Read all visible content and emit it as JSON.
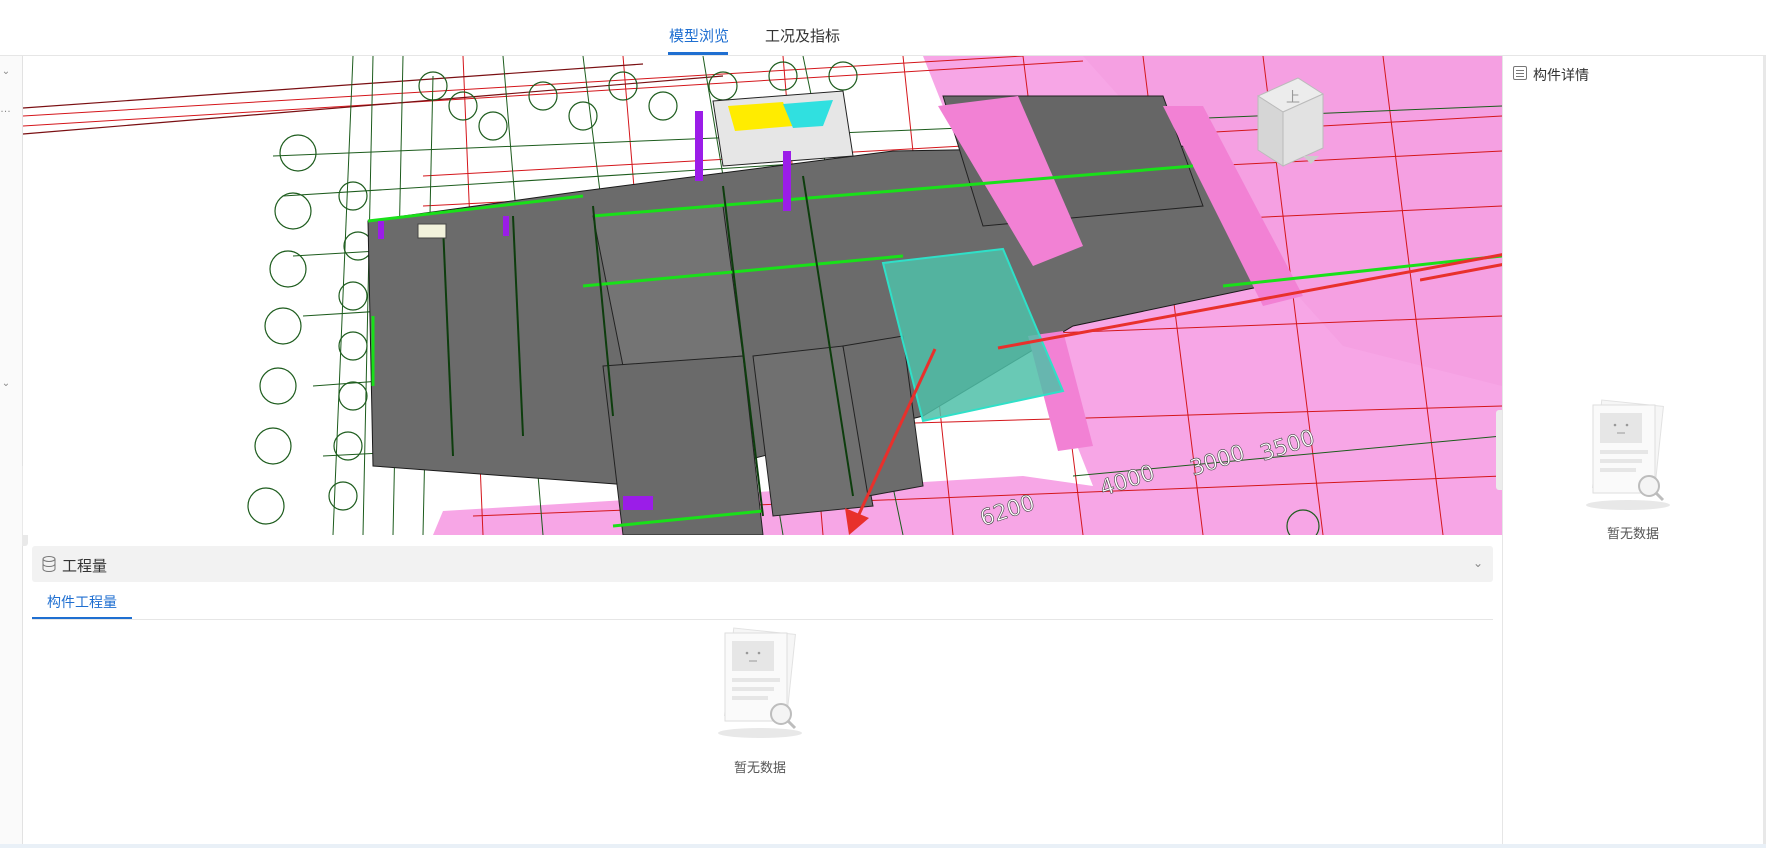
{
  "header": {
    "tabs": [
      {
        "label": "模型浏览",
        "active": true
      },
      {
        "label": "工况及指标",
        "active": false
      }
    ]
  },
  "quantity_panel": {
    "title": "工程量",
    "subtab": "构件工程量",
    "empty_text": "暂无数据"
  },
  "detail_panel": {
    "title": "构件详情",
    "empty_text": "暂无数据"
  },
  "viewport": {
    "nav_cube_label": "上",
    "dimension_labels": [
      "6200",
      "4000",
      "3000",
      "3500"
    ]
  },
  "colors": {
    "accent": "#1f6fd1",
    "slab": "#6b6b6b",
    "floor_pink": "#f7a6e6",
    "grid_red": "#d4161b",
    "axis_green": "#1d5c1d",
    "highlight_teal": "#4fbfa8",
    "arrow": "#e8302c"
  },
  "icons": [
    "chevron-down-icon",
    "database-icon",
    "list-icon",
    "empty-box-icon",
    "nav-cube-icon",
    "arrow-annotation-icon"
  ]
}
